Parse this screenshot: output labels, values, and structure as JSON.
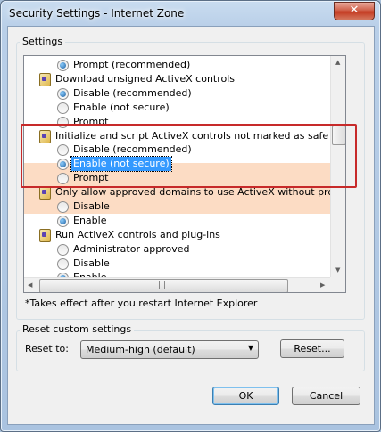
{
  "window": {
    "title": "Security Settings - Internet Zone",
    "close": "✕"
  },
  "settings": {
    "label": "Settings",
    "rows": [
      {
        "kind": "radio",
        "label": "Prompt (recommended)",
        "checked": true
      },
      {
        "kind": "category",
        "label": "Download unsigned ActiveX controls"
      },
      {
        "kind": "radio",
        "label": "Disable (recommended)",
        "checked": true
      },
      {
        "kind": "radio",
        "label": "Enable (not secure)",
        "checked": false
      },
      {
        "kind": "radio",
        "label": "Prompt",
        "checked": false
      },
      {
        "kind": "category",
        "label": "Initialize and script ActiveX controls not marked as safe for scrip"
      },
      {
        "kind": "radio",
        "label": "Disable (recommended)",
        "checked": false
      },
      {
        "kind": "radio",
        "label": "Enable (not secure)",
        "checked": true,
        "selected": true
      },
      {
        "kind": "radio",
        "label": "Prompt",
        "checked": false
      },
      {
        "kind": "category",
        "label": "Only allow approved domains to use ActiveX without prompt"
      },
      {
        "kind": "radio",
        "label": "Disable",
        "checked": false
      },
      {
        "kind": "radio",
        "label": "Enable",
        "checked": true
      },
      {
        "kind": "category",
        "label": "Run ActiveX controls and plug-ins"
      },
      {
        "kind": "radio",
        "label": "Administrator approved",
        "checked": false
      },
      {
        "kind": "radio",
        "label": "Disable",
        "checked": false
      },
      {
        "kind": "radio",
        "label": "Enable",
        "checked": true
      }
    ],
    "note": "*Takes effect after you restart Internet Explorer"
  },
  "reset": {
    "group_label": "Reset custom settings",
    "reset_to_label": "Reset to:",
    "level_value": "Medium-high (default)",
    "reset_button": "Reset..."
  },
  "buttons": {
    "ok": "OK",
    "cancel": "Cancel"
  },
  "icons": {
    "close": "close-icon",
    "setting": "activex-setting-icon",
    "scroll_up": "scroll-up-arrow-icon",
    "scroll_down": "scroll-down-arrow-icon",
    "scroll_left": "scroll-left-arrow-icon",
    "scroll_right": "scroll-right-arrow-icon",
    "dropdown": "chevron-down-icon"
  },
  "colors": {
    "highlight": "#fcdcc4",
    "selection": "#3399ff",
    "callout": "#c72a2a"
  }
}
